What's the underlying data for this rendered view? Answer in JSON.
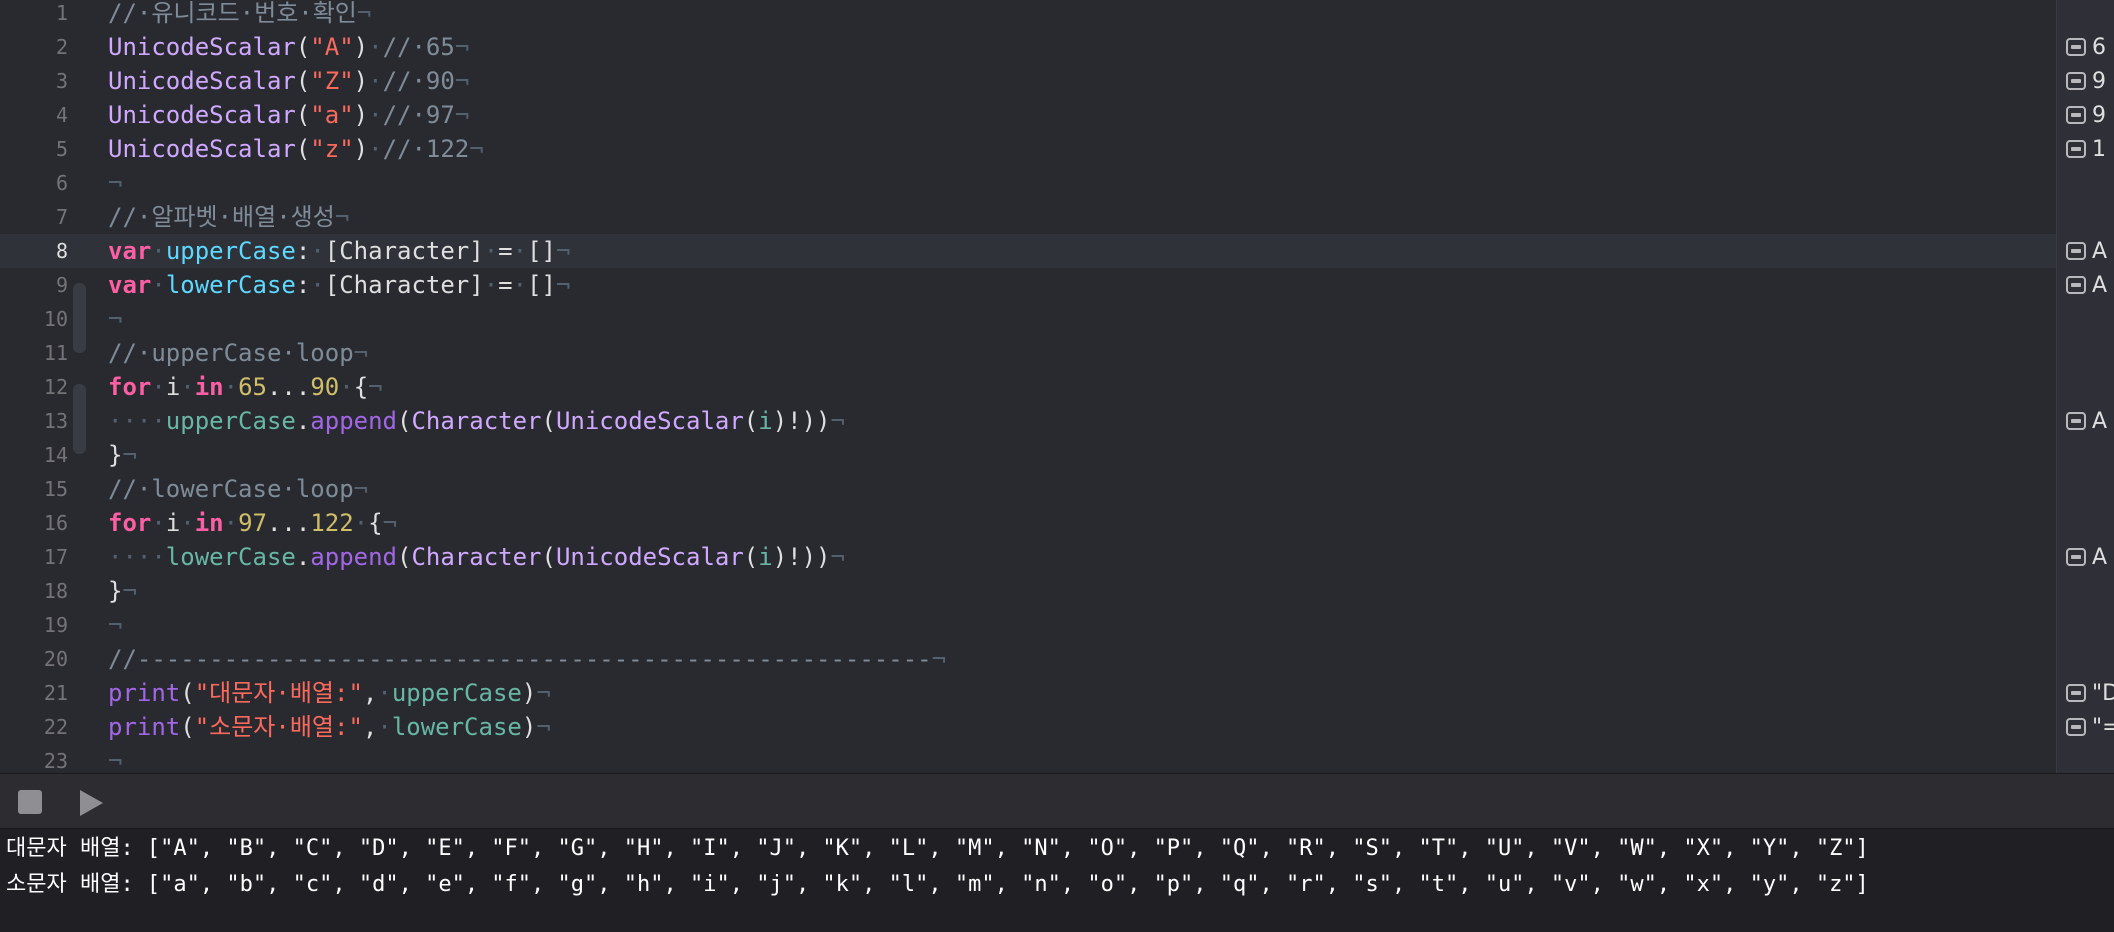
{
  "editor": {
    "current_line": 8,
    "lines": [
      {
        "n": "1",
        "tokens": [
          [
            "cmt",
            "//·유니코드·번호·확인"
          ],
          [
            "ws",
            "¬"
          ]
        ]
      },
      {
        "n": "2",
        "tokens": [
          [
            "type",
            "UnicodeScalar"
          ],
          [
            "plain",
            "("
          ],
          [
            "str",
            "\"A\""
          ],
          [
            "plain",
            ")"
          ],
          [
            "ws",
            "·"
          ],
          [
            "cmt",
            "//·65"
          ],
          [
            "ws",
            "¬"
          ]
        ]
      },
      {
        "n": "3",
        "tokens": [
          [
            "type",
            "UnicodeScalar"
          ],
          [
            "plain",
            "("
          ],
          [
            "str",
            "\"Z\""
          ],
          [
            "plain",
            ")"
          ],
          [
            "ws",
            "·"
          ],
          [
            "cmt",
            "//·90"
          ],
          [
            "ws",
            "¬"
          ]
        ]
      },
      {
        "n": "4",
        "tokens": [
          [
            "type",
            "UnicodeScalar"
          ],
          [
            "plain",
            "("
          ],
          [
            "str",
            "\"a\""
          ],
          [
            "plain",
            ")"
          ],
          [
            "ws",
            "·"
          ],
          [
            "cmt",
            "//·97"
          ],
          [
            "ws",
            "¬"
          ]
        ]
      },
      {
        "n": "5",
        "tokens": [
          [
            "type",
            "UnicodeScalar"
          ],
          [
            "plain",
            "("
          ],
          [
            "str",
            "\"z\""
          ],
          [
            "plain",
            ")"
          ],
          [
            "ws",
            "·"
          ],
          [
            "cmt",
            "//·122"
          ],
          [
            "ws",
            "¬"
          ]
        ]
      },
      {
        "n": "6",
        "tokens": [
          [
            "ws",
            "¬"
          ]
        ]
      },
      {
        "n": "7",
        "tokens": [
          [
            "cmt",
            "//·알파벳·배열·생성"
          ],
          [
            "ws",
            "¬"
          ]
        ]
      },
      {
        "n": "8",
        "tokens": [
          [
            "kw",
            "var"
          ],
          [
            "ws",
            "·"
          ],
          [
            "decl",
            "upperCase"
          ],
          [
            "plain",
            ":"
          ],
          [
            "ws",
            "·"
          ],
          [
            "plain",
            "[Character]"
          ],
          [
            "ws",
            "·"
          ],
          [
            "plain",
            "="
          ],
          [
            "ws",
            "·"
          ],
          [
            "plain",
            "[]"
          ],
          [
            "ws",
            "¬"
          ]
        ]
      },
      {
        "n": "9",
        "tokens": [
          [
            "kw",
            "var"
          ],
          [
            "ws",
            "·"
          ],
          [
            "decl",
            "lowerCase"
          ],
          [
            "plain",
            ":"
          ],
          [
            "ws",
            "·"
          ],
          [
            "plain",
            "[Character]"
          ],
          [
            "ws",
            "·"
          ],
          [
            "plain",
            "="
          ],
          [
            "ws",
            "·"
          ],
          [
            "plain",
            "[]"
          ],
          [
            "ws",
            "¬"
          ]
        ]
      },
      {
        "n": "10",
        "tokens": [
          [
            "ws",
            "¬"
          ]
        ]
      },
      {
        "n": "11",
        "tokens": [
          [
            "cmt",
            "//·upperCase·loop"
          ],
          [
            "ws",
            "¬"
          ]
        ]
      },
      {
        "n": "12",
        "tokens": [
          [
            "kw",
            "for"
          ],
          [
            "ws",
            "·"
          ],
          [
            "plain",
            "i"
          ],
          [
            "ws",
            "·"
          ],
          [
            "kw",
            "in"
          ],
          [
            "ws",
            "·"
          ],
          [
            "num",
            "65"
          ],
          [
            "plain",
            "..."
          ],
          [
            "num",
            "90"
          ],
          [
            "ws",
            "·"
          ],
          [
            "plain",
            "{"
          ],
          [
            "ws",
            "¬"
          ]
        ]
      },
      {
        "n": "13",
        "tokens": [
          [
            "ws",
            "····"
          ],
          [
            "var",
            "upperCase"
          ],
          [
            "plain",
            "."
          ],
          [
            "fn",
            "append"
          ],
          [
            "plain",
            "("
          ],
          [
            "type",
            "Character"
          ],
          [
            "plain",
            "("
          ],
          [
            "type",
            "UnicodeScalar"
          ],
          [
            "plain",
            "("
          ],
          [
            "var",
            "i"
          ],
          [
            "plain",
            ")!))"
          ],
          [
            "ws",
            "¬"
          ]
        ]
      },
      {
        "n": "14",
        "tokens": [
          [
            "plain",
            "}"
          ],
          [
            "ws",
            "¬"
          ]
        ]
      },
      {
        "n": "15",
        "tokens": [
          [
            "cmt",
            "//·lowerCase·loop"
          ],
          [
            "ws",
            "¬"
          ]
        ]
      },
      {
        "n": "16",
        "tokens": [
          [
            "kw",
            "for"
          ],
          [
            "ws",
            "·"
          ],
          [
            "plain",
            "i"
          ],
          [
            "ws",
            "·"
          ],
          [
            "kw",
            "in"
          ],
          [
            "ws",
            "·"
          ],
          [
            "num",
            "97"
          ],
          [
            "plain",
            "..."
          ],
          [
            "num",
            "122"
          ],
          [
            "ws",
            "·"
          ],
          [
            "plain",
            "{"
          ],
          [
            "ws",
            "¬"
          ]
        ]
      },
      {
        "n": "17",
        "tokens": [
          [
            "ws",
            "····"
          ],
          [
            "var",
            "lowerCase"
          ],
          [
            "plain",
            "."
          ],
          [
            "fn",
            "append"
          ],
          [
            "plain",
            "("
          ],
          [
            "type",
            "Character"
          ],
          [
            "plain",
            "("
          ],
          [
            "type",
            "UnicodeScalar"
          ],
          [
            "plain",
            "("
          ],
          [
            "var",
            "i"
          ],
          [
            "plain",
            ")!))"
          ],
          [
            "ws",
            "¬"
          ]
        ]
      },
      {
        "n": "18",
        "tokens": [
          [
            "plain",
            "}"
          ],
          [
            "ws",
            "¬"
          ]
        ]
      },
      {
        "n": "19",
        "tokens": [
          [
            "ws",
            "¬"
          ]
        ]
      },
      {
        "n": "20",
        "tokens": [
          [
            "cmt",
            "//-------------------------------------------------------"
          ],
          [
            "ws",
            "¬"
          ]
        ]
      },
      {
        "n": "21",
        "tokens": [
          [
            "fn",
            "print"
          ],
          [
            "plain",
            "("
          ],
          [
            "str",
            "\"대문자·배열:\""
          ],
          [
            "plain",
            ","
          ],
          [
            "ws",
            "·"
          ],
          [
            "var",
            "upperCase"
          ],
          [
            "plain",
            ")"
          ],
          [
            "ws",
            "¬"
          ]
        ]
      },
      {
        "n": "22",
        "tokens": [
          [
            "fn",
            "print"
          ],
          [
            "plain",
            "("
          ],
          [
            "str",
            "\"소문자·배열:\""
          ],
          [
            "plain",
            ","
          ],
          [
            "ws",
            "·"
          ],
          [
            "var",
            "lowerCase"
          ],
          [
            "plain",
            ")"
          ],
          [
            "ws",
            "¬"
          ]
        ]
      },
      {
        "n": "23",
        "tokens": [
          [
            "ws",
            "¬"
          ]
        ]
      }
    ]
  },
  "results": [
    {
      "line": 2,
      "text": "6"
    },
    {
      "line": 3,
      "text": "9"
    },
    {
      "line": 4,
      "text": "9"
    },
    {
      "line": 5,
      "text": "1"
    },
    {
      "line": 8,
      "text": "A"
    },
    {
      "line": 9,
      "text": "A"
    },
    {
      "line": 13,
      "text": "A"
    },
    {
      "line": 17,
      "text": "A"
    },
    {
      "line": 21,
      "text": "\"D"
    },
    {
      "line": 22,
      "text": "\"="
    }
  ],
  "debug_bar": {
    "stop_icon": "stop-icon",
    "run_icon": "play-icon"
  },
  "console": {
    "lines": [
      "대문자 배열: [\"A\", \"B\", \"C\", \"D\", \"E\", \"F\", \"G\", \"H\", \"I\", \"J\", \"K\", \"L\", \"M\", \"N\", \"O\", \"P\", \"Q\", \"R\", \"S\", \"T\", \"U\", \"V\", \"W\", \"X\", \"Y\", \"Z\"]",
      "소문자 배열: [\"a\", \"b\", \"c\", \"d\", \"e\", \"f\", \"g\", \"h\", \"i\", \"j\", \"k\", \"l\", \"m\", \"n\", \"o\", \"p\", \"q\", \"r\", \"s\", \"t\", \"u\", \"v\", \"w\", \"x\", \"y\", \"z\"]"
    ]
  },
  "colors": {
    "editor_bg": "#292a30",
    "keyword": "#fc5fa3",
    "string": "#fc6a5d",
    "number": "#d0bf69",
    "comment": "#7f8c98",
    "type": "#d0a8ff",
    "function": "#a167e6",
    "variable": "#67b7a4",
    "declaration": "#5dd8ff"
  }
}
